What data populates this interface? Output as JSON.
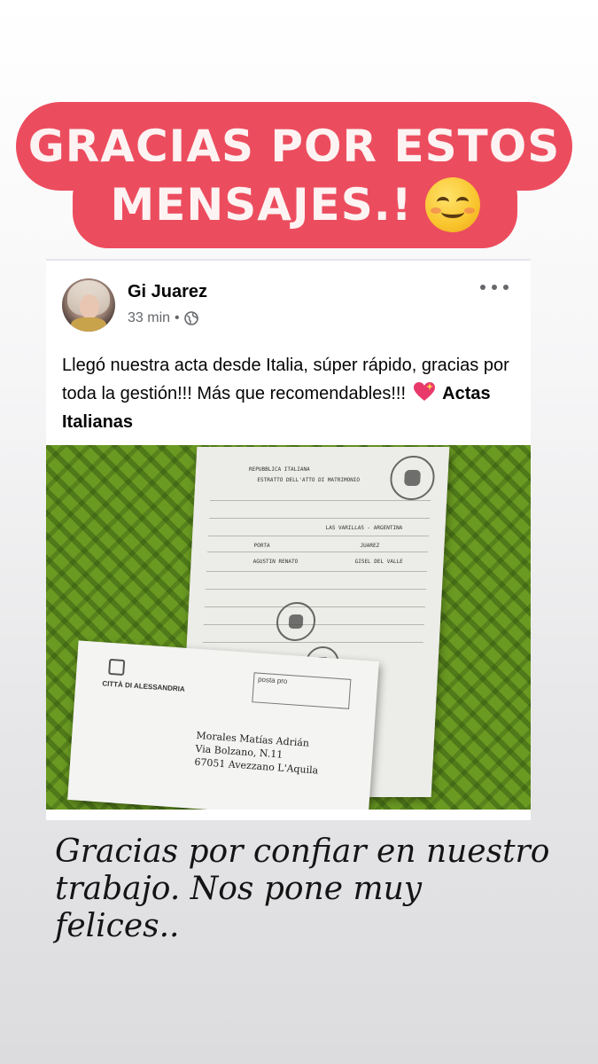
{
  "banner": {
    "line1": "GRACIAS POR ESTOS",
    "line2": "MENSAJES.!",
    "emoji": "smiling-face-emoji",
    "background_color": "#ec4d5e"
  },
  "post": {
    "author": "Gi Juarez",
    "time": "33 min",
    "separator": "•",
    "privacy_icon": "globe-icon",
    "menu_icon": "more-horizontal-icon",
    "text": "Llegó nuestra acta desde Italia, súper rápido, gracias por toda la gestión!!! Más que recomendables!!!",
    "text_emoji": "sparkling-heart-icon",
    "tagged_page": "Actas Italianas"
  },
  "photo": {
    "document_header": "REPUBBLICA ITALIANA",
    "document_title": "ESTRATTO DELL'ATTO DI MATRIMONIO",
    "location": "LAS VARILLAS - ARGENTINA",
    "groom_surname": "PORTA",
    "bride_surname": "JUAREZ",
    "groom_name": "AGUSTIN RENATO",
    "bride_name": "GISEL DEL VALLE",
    "envelope_sender": "CITTÀ DI ALESSANDRIA",
    "postmark": "posta pro",
    "address_lines": [
      "Morales Matías Adrián",
      "Via Bolzano, N.11",
      "67051 Avezzano L'Aquila"
    ]
  },
  "caption": "Gracias por confiar en nuestro trabajo. Nos pone muy felices.."
}
